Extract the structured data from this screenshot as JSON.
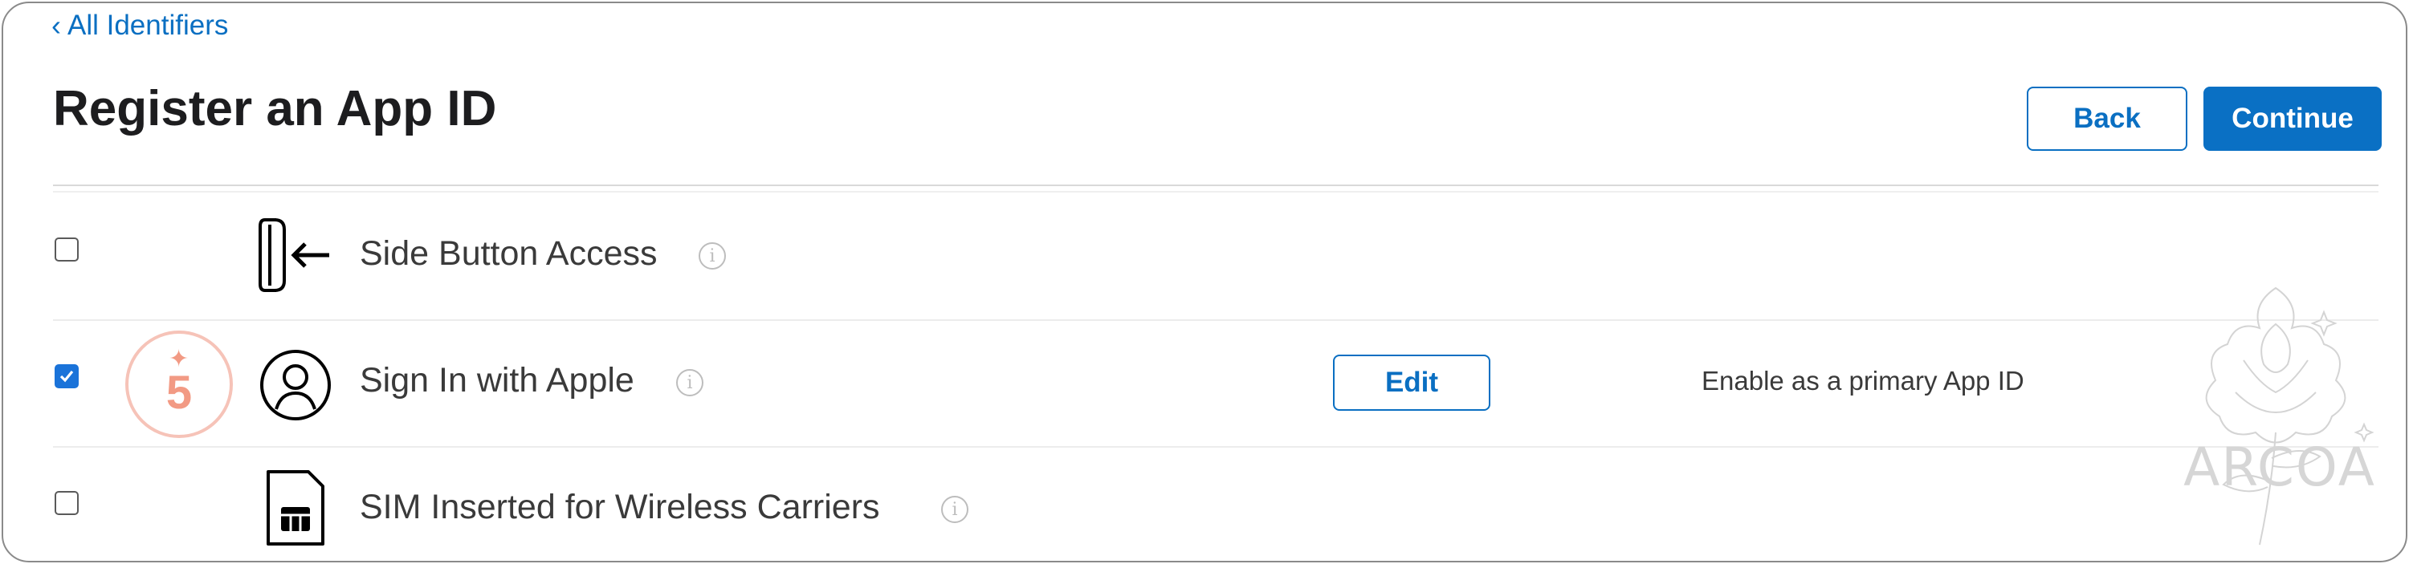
{
  "nav": {
    "back_chevron": "‹",
    "back_label": "All Identifiers"
  },
  "header": {
    "title": "Register an App ID",
    "back_button": "Back",
    "continue_button": "Continue"
  },
  "capabilities": [
    {
      "label": "Side Button Access",
      "checked": false,
      "icon": "side-button-icon",
      "info": "i"
    },
    {
      "label": "Sign In with Apple",
      "checked": true,
      "icon": "person-circle-icon",
      "info": "i",
      "action_label": "Edit",
      "note": "Enable as a primary App ID"
    },
    {
      "label": "SIM Inserted for Wireless Carriers",
      "checked": false,
      "icon": "sim-card-icon",
      "info": "i"
    }
  ],
  "step_badge": {
    "number": "5",
    "icon": "sparkle-icon"
  },
  "watermark": {
    "text": "ARCOA",
    "icon": "peony-flower-icon"
  },
  "colors": {
    "accent": "#0a70c4",
    "checkbox_checked": "#1a73d9",
    "badge": "#f29a84"
  }
}
